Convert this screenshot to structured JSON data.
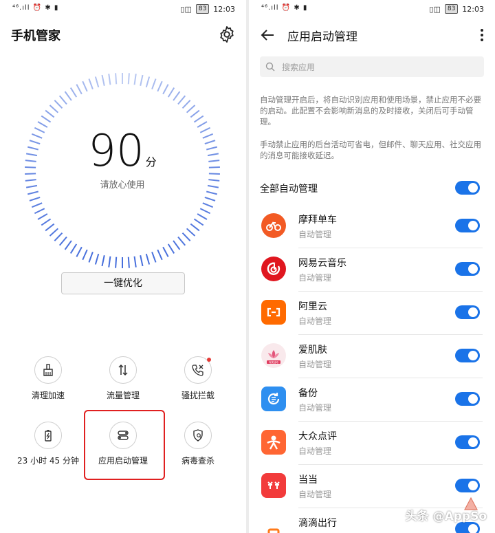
{
  "status": {
    "network": "⁴⁶.ıll ⏰ ✱ ▮",
    "icons": "▯◫",
    "battery": "83",
    "time": "12:03"
  },
  "left": {
    "title": "手机管家",
    "score": "90",
    "score_unit": "分",
    "score_hint": "请放心使用",
    "optimize_label": "一键优化",
    "tiles": [
      {
        "label": "清理加速",
        "icon": "broom-icon"
      },
      {
        "label": "流量管理",
        "icon": "data-traffic-icon"
      },
      {
        "label": "骚扰拦截",
        "icon": "phone-block-icon"
      },
      {
        "label": "23 小时 45 分钟",
        "icon": "battery-icon"
      },
      {
        "label": "应用启动管理",
        "icon": "app-launch-icon"
      },
      {
        "label": "病毒查杀",
        "icon": "virus-scan-icon"
      }
    ]
  },
  "right": {
    "title": "应用启动管理",
    "search_placeholder": "搜索应用",
    "desc1": "自动管理开启后，将自动识别应用和使用场景，禁止应用不必要的启动。此配置不会影响新消息的及时接收，关闭后可手动管理。",
    "desc2": "手动禁止应用的后台活动可省电，但邮件、聊天应用、社交应用的消息可能接收延迟。",
    "all_label": "全部自动管理",
    "all_on": true,
    "apps": [
      {
        "name": "摩拜单车",
        "sub": "自动管理",
        "on": true,
        "color": "#f25a24",
        "icon": "bike-icon"
      },
      {
        "name": "网易云音乐",
        "sub": "自动管理",
        "on": true,
        "color": "#e0161f",
        "icon": "music-icon"
      },
      {
        "name": "阿里云",
        "sub": "自动管理",
        "on": true,
        "color": "#ff6a00",
        "icon": "cloud-icon"
      },
      {
        "name": "爱肌肤",
        "sub": "自动管理",
        "on": true,
        "color": "#f9e9ec",
        "icon": "lotus-icon",
        "badge": "有奖活动"
      },
      {
        "name": "备份",
        "sub": "自动管理",
        "on": true,
        "color": "#2e8ff0",
        "icon": "backup-icon"
      },
      {
        "name": "大众点评",
        "sub": "自动管理",
        "on": true,
        "color": "#ff6633",
        "icon": "dianping-icon"
      },
      {
        "name": "当当",
        "sub": "自动管理",
        "on": true,
        "color": "#f23b3b",
        "icon": "dangdang-icon"
      },
      {
        "name": "滴滴出行",
        "sub": "",
        "on": true,
        "color": "#ff7a1a",
        "icon": "didi-icon"
      }
    ]
  },
  "watermark": "头条 @AppSo",
  "colors": {
    "accent": "#1a73e8",
    "highlight": "#e02020"
  }
}
